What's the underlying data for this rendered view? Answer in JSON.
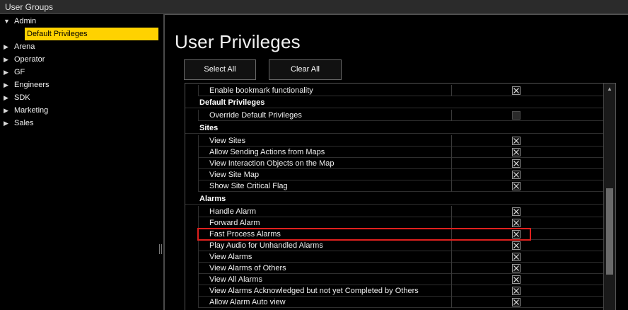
{
  "window": {
    "title": "User Groups"
  },
  "tree": {
    "items": [
      {
        "label": "Admin",
        "arrow": "▼",
        "expanded": true
      },
      {
        "label": "Arena",
        "arrow": "▶"
      },
      {
        "label": "Operator",
        "arrow": "▶"
      },
      {
        "label": "GF",
        "arrow": "▶"
      },
      {
        "label": "Engineers",
        "arrow": "▶"
      },
      {
        "label": "SDK",
        "arrow": "▶"
      },
      {
        "label": "Marketing",
        "arrow": "▶"
      },
      {
        "label": "Sales",
        "arrow": "▶"
      }
    ],
    "selected_child": "Default Privileges"
  },
  "main": {
    "title": "User Privileges",
    "select_all_label": "Select All",
    "clear_all_label": "Clear All"
  },
  "privileges": {
    "rows": [
      {
        "type": "item",
        "name": "Enable bookmark functionality",
        "checked": true
      },
      {
        "type": "header",
        "name": "Default Privileges"
      },
      {
        "type": "item",
        "name": "Override Default Privileges",
        "checked": false
      },
      {
        "type": "header",
        "name": "Sites"
      },
      {
        "type": "item",
        "name": "View Sites",
        "checked": true
      },
      {
        "type": "item",
        "name": "Allow Sending Actions from Maps",
        "checked": true
      },
      {
        "type": "item",
        "name": "View Interaction Objects on the Map",
        "checked": true
      },
      {
        "type": "item",
        "name": "View Site Map",
        "checked": true
      },
      {
        "type": "item",
        "name": "Show Site Critical Flag",
        "checked": true
      },
      {
        "type": "header",
        "name": "Alarms"
      },
      {
        "type": "item",
        "name": "Handle Alarm",
        "checked": true
      },
      {
        "type": "item",
        "name": "Forward Alarm",
        "checked": true
      },
      {
        "type": "item",
        "name": "Fast Process Alarms",
        "checked": true,
        "highlighted": true
      },
      {
        "type": "item",
        "name": "Play Audio for Unhandled Alarms",
        "checked": true
      },
      {
        "type": "item",
        "name": "View Alarms",
        "checked": true
      },
      {
        "type": "item",
        "name": "View Alarms of Others",
        "checked": true
      },
      {
        "type": "item",
        "name": "View All Alarms",
        "checked": true
      },
      {
        "type": "item",
        "name": "View Alarms Acknowledged but not yet Completed by Others",
        "checked": true
      },
      {
        "type": "item",
        "name": "Allow Alarm Auto view",
        "checked": true
      }
    ]
  },
  "colors": {
    "selection": "#ffd200",
    "highlight_border": "#e0201e"
  }
}
